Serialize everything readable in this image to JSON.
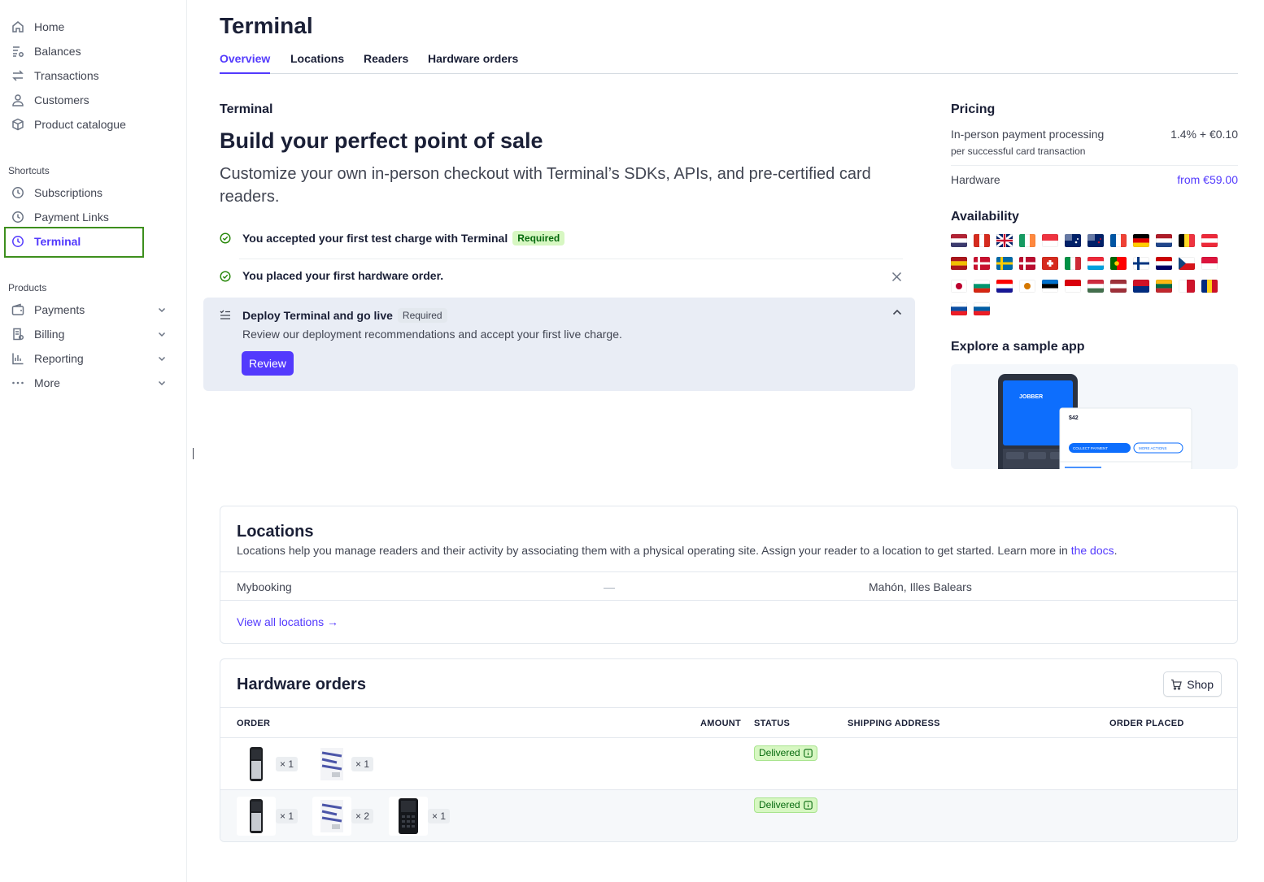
{
  "sidebar": {
    "main": [
      {
        "label": "Home",
        "icon": "home-icon"
      },
      {
        "label": "Balances",
        "icon": "balances-icon"
      },
      {
        "label": "Transactions",
        "icon": "transactions-icon"
      },
      {
        "label": "Customers",
        "icon": "customers-icon"
      },
      {
        "label": "Product catalogue",
        "icon": "product-catalogue-icon"
      }
    ],
    "shortcuts_title": "Shortcuts",
    "shortcuts": [
      {
        "label": "Subscriptions",
        "icon": "clock-icon"
      },
      {
        "label": "Payment Links",
        "icon": "clock-icon"
      },
      {
        "label": "Terminal",
        "icon": "clock-icon",
        "active": true
      }
    ],
    "products_title": "Products",
    "products": [
      {
        "label": "Payments",
        "icon": "wallet-icon"
      },
      {
        "label": "Billing",
        "icon": "billing-icon"
      },
      {
        "label": "Reporting",
        "icon": "chart-icon"
      },
      {
        "label": "More",
        "icon": "dots-icon"
      }
    ]
  },
  "header": {
    "title": "Terminal",
    "tabs": [
      {
        "label": "Overview",
        "active": true
      },
      {
        "label": "Locations"
      },
      {
        "label": "Readers"
      },
      {
        "label": "Hardware orders"
      }
    ]
  },
  "overview": {
    "section_label": "Terminal",
    "hero_title": "Build your perfect point of sale",
    "hero_subtitle": "Customize your own in-person checkout with Terminal’s SDKs, APIs, and pre-certified card readers.",
    "tasks": [
      {
        "text": "You accepted your first test charge with Terminal",
        "badge": "Required",
        "done": true
      },
      {
        "text": "You placed your first hardware order.",
        "done": true
      }
    ],
    "deploy": {
      "title": "Deploy Terminal and go live",
      "badge": "Required",
      "description": "Review our deployment recommendations and accept your first live charge.",
      "button": "Review"
    }
  },
  "pricing": {
    "title": "Pricing",
    "items": [
      {
        "label": "In-person payment processing",
        "sub": "per successful card transaction",
        "value": "1.4% + €0.10"
      },
      {
        "label": "Hardware",
        "value": "from €59.00"
      }
    ]
  },
  "availability": {
    "title": "Availability",
    "flags": [
      "us",
      "ca",
      "gb",
      "ie",
      "sg",
      "au",
      "nz",
      "fr",
      "de",
      "nl",
      "be",
      "at",
      "es",
      "dk",
      "se",
      "no",
      "ch",
      "it",
      "lu",
      "pt",
      "fi",
      "my",
      "cz",
      "pl",
      "jp",
      "bg",
      "hr",
      "cy",
      "ee",
      "gi",
      "hu",
      "lv",
      "li",
      "lt",
      "mt",
      "ro",
      "sk",
      "si"
    ]
  },
  "sample_app": {
    "title": "Explore a sample app",
    "brand": "JOBBER",
    "amount": "$42",
    "collect": "COLLECT PAYMENT",
    "more": "MORE ACTIONS"
  },
  "locations": {
    "title": "Locations",
    "description": "Locations help you manage readers and their activity by associating them with a physical operating site. Assign your reader to a location to get started. Learn more in ",
    "docs_link": "the docs",
    "rows": [
      {
        "name": "Mybooking",
        "dash": "—",
        "city": "Mahón, Illes Balears"
      }
    ],
    "view_all": "View all locations →"
  },
  "hardware_orders": {
    "title": "Hardware orders",
    "shop_label": "Shop",
    "columns": [
      "ORDER",
      "AMOUNT",
      "STATUS",
      "SHIPPING ADDRESS",
      "ORDER PLACED"
    ],
    "orders": [
      {
        "items": [
          {
            "type": "reader-m2",
            "qty": "× 1"
          },
          {
            "type": "kit",
            "qty": "× 1"
          }
        ],
        "status": "Delivered"
      },
      {
        "items": [
          {
            "type": "reader-m2",
            "qty": "× 1"
          },
          {
            "type": "kit",
            "qty": "× 2"
          },
          {
            "type": "reader-wisepad",
            "qty": "× 1"
          }
        ],
        "status": "Delivered"
      }
    ]
  },
  "colors": {
    "accent": "#533afd",
    "success_bg": "#d7f7c2",
    "success_text": "#05690d",
    "highlight_outline": "#3d8f1d"
  }
}
